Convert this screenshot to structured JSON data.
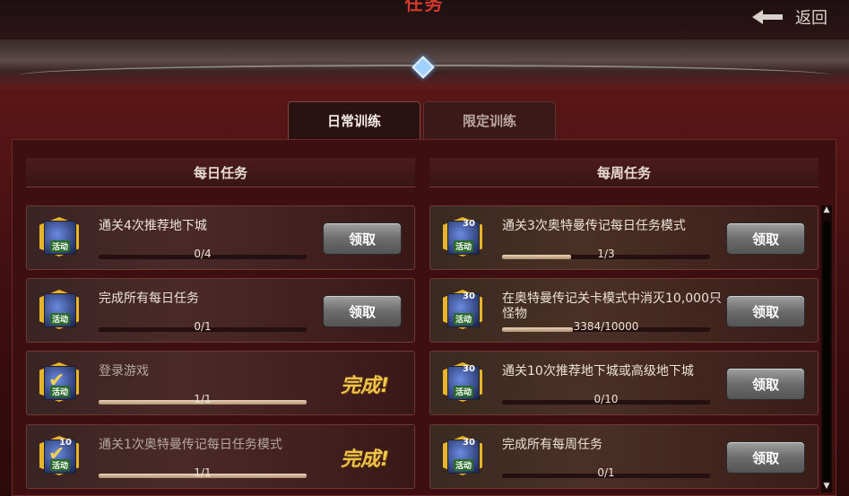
{
  "header": {
    "title": "任务",
    "back_label": "返回"
  },
  "tabs": [
    {
      "label": "日常训练",
      "active": true
    },
    {
      "label": "限定训练",
      "active": false
    }
  ],
  "daily": {
    "heading": "每日任务",
    "tasks": [
      {
        "text": "通关4次推荐地下城",
        "progress": "0/4",
        "fraction": 0,
        "action": "领取",
        "status": "claim",
        "icon_tag": "活动"
      },
      {
        "text": "完成所有每日任务",
        "progress": "0/1",
        "fraction": 0,
        "action": "领取",
        "status": "claim",
        "icon_tag": "活动"
      },
      {
        "text": "登录游戏",
        "progress": "1/1",
        "fraction": 1,
        "action": "完成!",
        "status": "done",
        "icon_tag": "活动"
      },
      {
        "text": "通关1次奥特曼传记每日任务模式",
        "progress": "1/1",
        "fraction": 1,
        "action": "完成!",
        "status": "done",
        "icon_tag": "活动",
        "icon_num": "10"
      }
    ]
  },
  "weekly": {
    "heading": "每周任务",
    "tasks": [
      {
        "text": "通关3次奥特曼传记每日任务模式",
        "progress": "1/3",
        "fraction": 0.333,
        "action": "领取",
        "icon_tag": "活动",
        "icon_num": "30"
      },
      {
        "text": "在奥特曼传记关卡模式中消灭10,000只怪物",
        "progress": "3384/10000",
        "fraction": 0.338,
        "action": "领取",
        "icon_tag": "活动",
        "icon_num": "30"
      },
      {
        "text": "通关10次推荐地下城或高级地下城",
        "progress": "0/10",
        "fraction": 0,
        "action": "领取",
        "icon_tag": "活动",
        "icon_num": "30"
      },
      {
        "text": "完成所有每周任务",
        "progress": "0/1",
        "fraction": 0,
        "action": "领取",
        "icon_tag": "活动",
        "icon_num": "30"
      }
    ]
  }
}
